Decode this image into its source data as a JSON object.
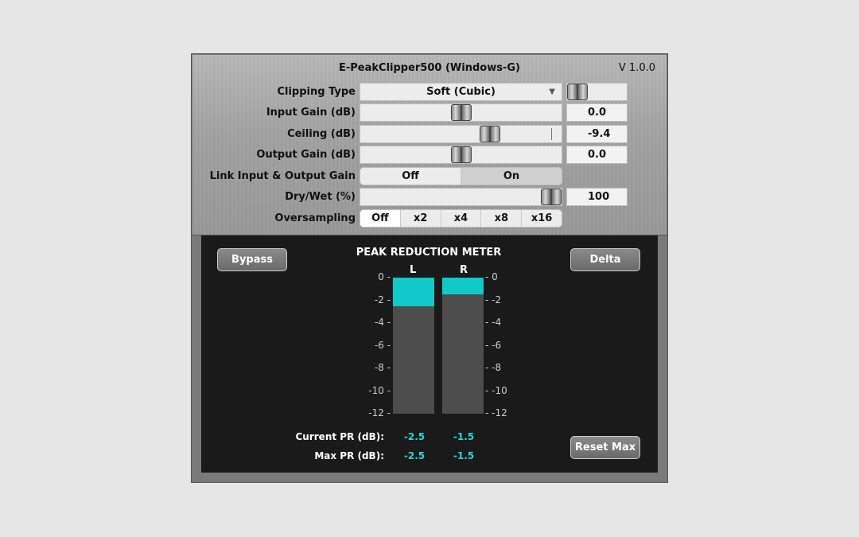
{
  "header": {
    "title": "E-PeakClipper500 (Windows-G)",
    "version": "V 1.0.0"
  },
  "controls": {
    "clipping_type": {
      "label": "Clipping Type",
      "value": "Soft (Cubic)"
    },
    "input_gain": {
      "label": "Input Gain (dB)",
      "value": "0.0",
      "level": 0.5
    },
    "ceiling": {
      "label": "Ceiling (dB)",
      "value": "-9.4",
      "level": 0.66
    },
    "output_gain": {
      "label": "Output Gain (dB)",
      "value": "0.0",
      "level": 0.5
    },
    "link": {
      "label": "Link Input & Output Gain",
      "options": [
        "Off",
        "On"
      ],
      "selected": "On"
    },
    "dry_wet": {
      "label": "Dry/Wet (%)",
      "value": "100",
      "level": 1.0
    },
    "oversampling": {
      "label": "Oversampling",
      "options": [
        "Off",
        "x2",
        "x4",
        "x8",
        "x16"
      ],
      "selected": "Off"
    }
  },
  "meter": {
    "title": "PEAK REDUCTION METER",
    "left_label": "L",
    "right_label": "R",
    "ticks": [
      "0",
      "-2",
      "-4",
      "-6",
      "-8",
      "-10",
      "-12"
    ],
    "left_reduction_db": -2.5,
    "right_reduction_db": -1.5,
    "current_label": "Current PR (dB):",
    "max_label": "Max PR (dB):",
    "current_left": "-2.5",
    "current_right": "-1.5",
    "max_left": "-2.5",
    "max_right": "-1.5"
  },
  "buttons": {
    "bypass": "Bypass",
    "delta": "Delta",
    "reset_max": "Reset Max"
  },
  "colors": {
    "meter_fill": "#12c9c9",
    "value_text": "#2ad6d6",
    "panel_dark": "#1a1a1a"
  }
}
